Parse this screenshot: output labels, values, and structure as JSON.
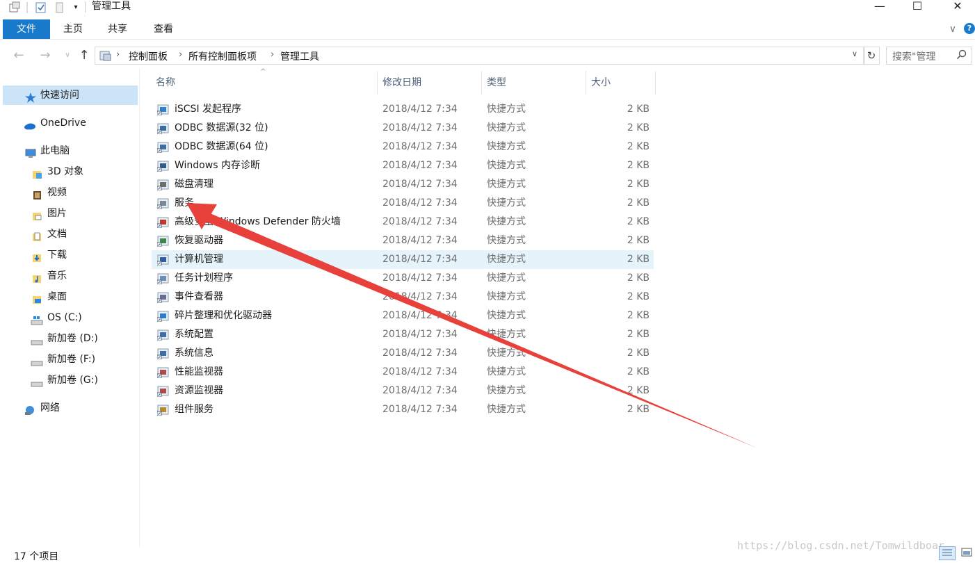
{
  "window": {
    "title": "管理工具",
    "minimize": "—",
    "maximize": "☐",
    "close": "✕"
  },
  "ribbon": {
    "tabs": [
      "文件",
      "主页",
      "共享",
      "查看"
    ],
    "collapse": "∨",
    "help": "?"
  },
  "address": {
    "crumbs": [
      "控制面板",
      "所有控制面板项",
      "管理工具"
    ],
    "search_placeholder": "搜索\"管理"
  },
  "nav": {
    "items": [
      {
        "label": "快速访问",
        "icon": "star-icon"
      },
      {
        "label": "OneDrive",
        "icon": "cloud-icon"
      },
      {
        "label": "此电脑",
        "icon": "computer-icon"
      },
      {
        "label": "3D 对象",
        "icon": "3d-folder-icon"
      },
      {
        "label": "视频",
        "icon": "video-folder-icon"
      },
      {
        "label": "图片",
        "icon": "pictures-folder-icon"
      },
      {
        "label": "文档",
        "icon": "documents-folder-icon"
      },
      {
        "label": "下载",
        "icon": "downloads-folder-icon"
      },
      {
        "label": "音乐",
        "icon": "music-folder-icon"
      },
      {
        "label": "桌面",
        "icon": "desktop-folder-icon"
      },
      {
        "label": "OS (C:)",
        "icon": "windows-drive-icon"
      },
      {
        "label": "新加卷 (D:)",
        "icon": "drive-icon"
      },
      {
        "label": "新加卷 (F:)",
        "icon": "drive-icon"
      },
      {
        "label": "新加卷 (G:)",
        "icon": "drive-icon"
      },
      {
        "label": "网络",
        "icon": "network-icon"
      }
    ]
  },
  "columns": {
    "name": "名称",
    "date": "修改日期",
    "type": "类型",
    "size": "大小"
  },
  "files": [
    {
      "name": "iSCSI 发起程序",
      "date": "2018/4/12 7:34",
      "type": "快捷方式",
      "size": "2 KB"
    },
    {
      "name": "ODBC 数据源(32 位)",
      "date": "2018/4/12 7:34",
      "type": "快捷方式",
      "size": "2 KB"
    },
    {
      "name": "ODBC 数据源(64 位)",
      "date": "2018/4/12 7:34",
      "type": "快捷方式",
      "size": "2 KB"
    },
    {
      "name": "Windows 内存诊断",
      "date": "2018/4/12 7:34",
      "type": "快捷方式",
      "size": "2 KB"
    },
    {
      "name": "磁盘清理",
      "date": "2018/4/12 7:34",
      "type": "快捷方式",
      "size": "2 KB"
    },
    {
      "name": "服务",
      "date": "2018/4/12 7:34",
      "type": "快捷方式",
      "size": "2 KB"
    },
    {
      "name": "高级安全 Windows Defender 防火墙",
      "date": "2018/4/12 7:34",
      "type": "快捷方式",
      "size": "2 KB"
    },
    {
      "name": "恢复驱动器",
      "date": "2018/4/12 7:34",
      "type": "快捷方式",
      "size": "2 KB"
    },
    {
      "name": "计算机管理",
      "date": "2018/4/12 7:34",
      "type": "快捷方式",
      "size": "2 KB"
    },
    {
      "name": "任务计划程序",
      "date": "2018/4/12 7:34",
      "type": "快捷方式",
      "size": "2 KB"
    },
    {
      "name": "事件查看器",
      "date": "2018/4/12 7:34",
      "type": "快捷方式",
      "size": "2 KB"
    },
    {
      "name": "碎片整理和优化驱动器",
      "date": "2018/4/12 7:34",
      "type": "快捷方式",
      "size": "2 KB"
    },
    {
      "name": "系统配置",
      "date": "2018/4/12 7:34",
      "type": "快捷方式",
      "size": "2 KB"
    },
    {
      "name": "系统信息",
      "date": "2018/4/12 7:34",
      "type": "快捷方式",
      "size": "2 KB"
    },
    {
      "name": "性能监视器",
      "date": "2018/4/12 7:34",
      "type": "快捷方式",
      "size": "2 KB"
    },
    {
      "name": "资源监视器",
      "date": "2018/4/12 7:34",
      "type": "快捷方式",
      "size": "2 KB"
    },
    {
      "name": "组件服务",
      "date": "2018/4/12 7:34",
      "type": "快捷方式",
      "size": "2 KB"
    }
  ],
  "selected_file": "计算机管理",
  "status": {
    "item_count": "17 个项目"
  },
  "watermark": "https://blog.csdn.net/Tomwildboar",
  "colors": {
    "accent": "#1979ca",
    "selection": "#e5f3fb",
    "nav_selected": "#cce4f7",
    "arrow": "#e8403a"
  }
}
